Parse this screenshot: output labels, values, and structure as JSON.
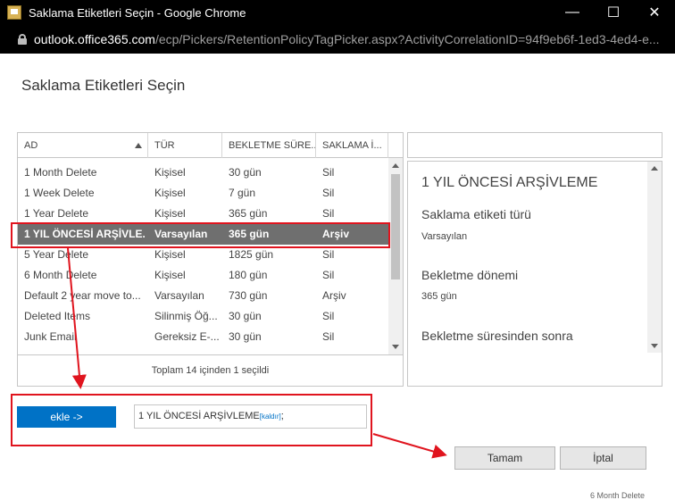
{
  "window": {
    "title": "Saklama Etiketleri Seçin - Google Chrome",
    "minimize_glyph": "—",
    "maximize_glyph": "☐",
    "close_glyph": "✕"
  },
  "address": {
    "domain": "outlook.office365.com",
    "path": "/ecp/Pickers/RetentionPolicyTagPicker.aspx?ActivityCorrelationID=94f9eb6f-1ed3-4ed4-e..."
  },
  "dialog": {
    "title": "Saklama Etiketleri Seçin"
  },
  "grid": {
    "columns": [
      "AD",
      "TÜR",
      "BEKLETME SÜRE...",
      "SAKLAMA İ..."
    ],
    "rows": [
      {
        "name": "1 Month Delete",
        "type": "Kişisel",
        "period": "30 gün",
        "action": "Sil"
      },
      {
        "name": "1 Week Delete",
        "type": "Kişisel",
        "period": "7 gün",
        "action": "Sil"
      },
      {
        "name": "1 Year Delete",
        "type": "Kişisel",
        "period": "365 gün",
        "action": "Sil"
      },
      {
        "name": "1 YIL ÖNCESİ ARŞİVLE...",
        "type": "Varsayılan",
        "period": "365 gün",
        "action": "Arşiv"
      },
      {
        "name": "5 Year Delete",
        "type": "Kişisel",
        "period": "1825 gün",
        "action": "Sil"
      },
      {
        "name": "6 Month Delete",
        "type": "Kişisel",
        "period": "180 gün",
        "action": "Sil"
      },
      {
        "name": "Default 2 year move to...",
        "type": "Varsayılan",
        "period": "730 gün",
        "action": "Arşiv"
      },
      {
        "name": "Deleted Items",
        "type": "Silinmiş Öğ...",
        "period": "30 gün",
        "action": "Sil"
      },
      {
        "name": "Junk Email",
        "type": "Gereksiz E-...",
        "period": "30 gün",
        "action": "Sil"
      }
    ],
    "selected_index": 3,
    "footer": "Toplam 14 içinden 1 seçildi"
  },
  "details": {
    "name": "1 YIL ÖNCESİ ARŞİVLEME",
    "type_label": "Saklama etiketi türü",
    "type_value": "Varsayılan",
    "period_label": "Bekletme dönemi",
    "period_value": "365 gün",
    "after_label": "Bekletme süresinden sonra"
  },
  "add": {
    "button_label": "ekle ->",
    "selected_item": "1 YIL ÖNCESİ ARŞİVLEME",
    "remove_label": "[kaldır]",
    "separator": ";"
  },
  "buttons": {
    "ok": "Tamam",
    "cancel": "İptal"
  },
  "background_peek": "6 Month Delete",
  "colors": {
    "accent": "#0072c6",
    "selection": "#6f6f6f",
    "annotation": "#e0141e"
  }
}
